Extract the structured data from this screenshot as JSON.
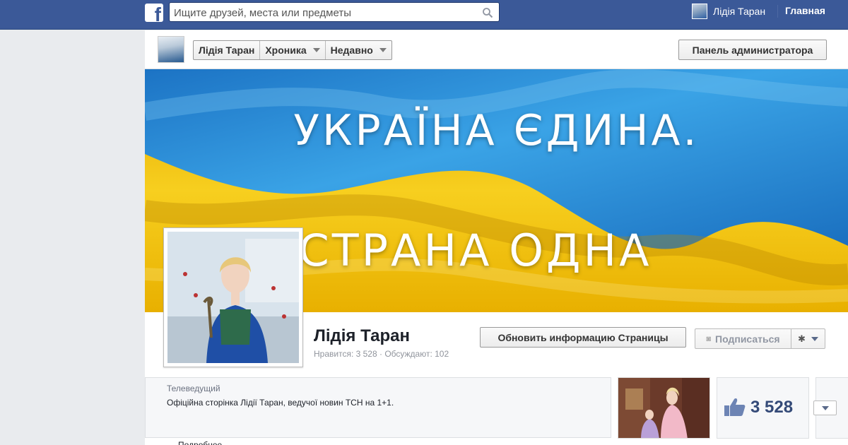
{
  "topbar": {
    "logo": "f",
    "search_placeholder": "Ищите друзей, места или предметы",
    "user_name": "Лідія Таран",
    "home_label": "Главная",
    "icons": [
      "facebook-logo-icon",
      "search-icon"
    ]
  },
  "subbar": {
    "crumbs": [
      "Лідія Таран",
      "Хроника",
      "Недавно"
    ],
    "admin_label": "Панель администратора"
  },
  "cover": {
    "line1": "УКРАЇНА ЄДИНА.",
    "line2": "СТРАНА ОДНА",
    "colors": {
      "blue": "#2b8fd6",
      "yellow": "#f2c100"
    }
  },
  "profile": {
    "name": "Лідія Таран",
    "stats": "Нравится: 3 528 · Обсуждают: 102",
    "update_label": "Обновить информацию Страницы",
    "subscribe_label": "Подписаться"
  },
  "info": {
    "category": "Телеведущий",
    "description": "Офіційна сторінка Лідії Таран, ведучої новин ТСН на 1+1.",
    "cut_text": "Подробнее"
  },
  "likes": {
    "count": "3 528"
  },
  "colors": {
    "fb_blue": "#3b5998",
    "link_blue": "#344a78"
  }
}
